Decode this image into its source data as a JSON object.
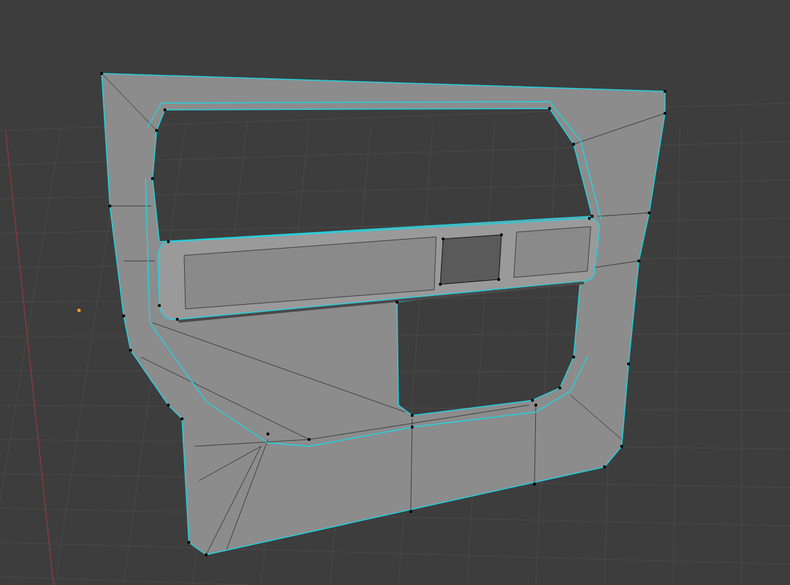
{
  "viewport": {
    "show_vertices": true,
    "show_grid": true
  }
}
